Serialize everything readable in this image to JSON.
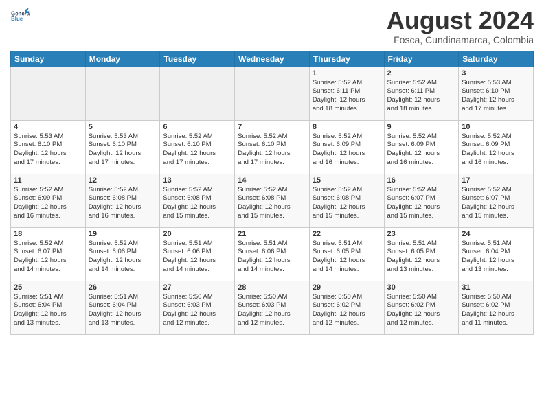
{
  "header": {
    "logo_general": "General",
    "logo_blue": "Blue",
    "month_year": "August 2024",
    "location": "Fosca, Cundinamarca, Colombia"
  },
  "weekdays": [
    "Sunday",
    "Monday",
    "Tuesday",
    "Wednesday",
    "Thursday",
    "Friday",
    "Saturday"
  ],
  "weeks": [
    [
      {
        "day": "",
        "info": ""
      },
      {
        "day": "",
        "info": ""
      },
      {
        "day": "",
        "info": ""
      },
      {
        "day": "",
        "info": ""
      },
      {
        "day": "1",
        "info": "Sunrise: 5:52 AM\nSunset: 6:11 PM\nDaylight: 12 hours\nand 18 minutes."
      },
      {
        "day": "2",
        "info": "Sunrise: 5:52 AM\nSunset: 6:11 PM\nDaylight: 12 hours\nand 18 minutes."
      },
      {
        "day": "3",
        "info": "Sunrise: 5:53 AM\nSunset: 6:10 PM\nDaylight: 12 hours\nand 17 minutes."
      }
    ],
    [
      {
        "day": "4",
        "info": "Sunrise: 5:53 AM\nSunset: 6:10 PM\nDaylight: 12 hours\nand 17 minutes."
      },
      {
        "day": "5",
        "info": "Sunrise: 5:53 AM\nSunset: 6:10 PM\nDaylight: 12 hours\nand 17 minutes."
      },
      {
        "day": "6",
        "info": "Sunrise: 5:52 AM\nSunset: 6:10 PM\nDaylight: 12 hours\nand 17 minutes."
      },
      {
        "day": "7",
        "info": "Sunrise: 5:52 AM\nSunset: 6:10 PM\nDaylight: 12 hours\nand 17 minutes."
      },
      {
        "day": "8",
        "info": "Sunrise: 5:52 AM\nSunset: 6:09 PM\nDaylight: 12 hours\nand 16 minutes."
      },
      {
        "day": "9",
        "info": "Sunrise: 5:52 AM\nSunset: 6:09 PM\nDaylight: 12 hours\nand 16 minutes."
      },
      {
        "day": "10",
        "info": "Sunrise: 5:52 AM\nSunset: 6:09 PM\nDaylight: 12 hours\nand 16 minutes."
      }
    ],
    [
      {
        "day": "11",
        "info": "Sunrise: 5:52 AM\nSunset: 6:09 PM\nDaylight: 12 hours\nand 16 minutes."
      },
      {
        "day": "12",
        "info": "Sunrise: 5:52 AM\nSunset: 6:08 PM\nDaylight: 12 hours\nand 16 minutes."
      },
      {
        "day": "13",
        "info": "Sunrise: 5:52 AM\nSunset: 6:08 PM\nDaylight: 12 hours\nand 15 minutes."
      },
      {
        "day": "14",
        "info": "Sunrise: 5:52 AM\nSunset: 6:08 PM\nDaylight: 12 hours\nand 15 minutes."
      },
      {
        "day": "15",
        "info": "Sunrise: 5:52 AM\nSunset: 6:08 PM\nDaylight: 12 hours\nand 15 minutes."
      },
      {
        "day": "16",
        "info": "Sunrise: 5:52 AM\nSunset: 6:07 PM\nDaylight: 12 hours\nand 15 minutes."
      },
      {
        "day": "17",
        "info": "Sunrise: 5:52 AM\nSunset: 6:07 PM\nDaylight: 12 hours\nand 15 minutes."
      }
    ],
    [
      {
        "day": "18",
        "info": "Sunrise: 5:52 AM\nSunset: 6:07 PM\nDaylight: 12 hours\nand 14 minutes."
      },
      {
        "day": "19",
        "info": "Sunrise: 5:52 AM\nSunset: 6:06 PM\nDaylight: 12 hours\nand 14 minutes."
      },
      {
        "day": "20",
        "info": "Sunrise: 5:51 AM\nSunset: 6:06 PM\nDaylight: 12 hours\nand 14 minutes."
      },
      {
        "day": "21",
        "info": "Sunrise: 5:51 AM\nSunset: 6:06 PM\nDaylight: 12 hours\nand 14 minutes."
      },
      {
        "day": "22",
        "info": "Sunrise: 5:51 AM\nSunset: 6:05 PM\nDaylight: 12 hours\nand 14 minutes."
      },
      {
        "day": "23",
        "info": "Sunrise: 5:51 AM\nSunset: 6:05 PM\nDaylight: 12 hours\nand 13 minutes."
      },
      {
        "day": "24",
        "info": "Sunrise: 5:51 AM\nSunset: 6:04 PM\nDaylight: 12 hours\nand 13 minutes."
      }
    ],
    [
      {
        "day": "25",
        "info": "Sunrise: 5:51 AM\nSunset: 6:04 PM\nDaylight: 12 hours\nand 13 minutes."
      },
      {
        "day": "26",
        "info": "Sunrise: 5:51 AM\nSunset: 6:04 PM\nDaylight: 12 hours\nand 13 minutes."
      },
      {
        "day": "27",
        "info": "Sunrise: 5:50 AM\nSunset: 6:03 PM\nDaylight: 12 hours\nand 12 minutes."
      },
      {
        "day": "28",
        "info": "Sunrise: 5:50 AM\nSunset: 6:03 PM\nDaylight: 12 hours\nand 12 minutes."
      },
      {
        "day": "29",
        "info": "Sunrise: 5:50 AM\nSunset: 6:02 PM\nDaylight: 12 hours\nand 12 minutes."
      },
      {
        "day": "30",
        "info": "Sunrise: 5:50 AM\nSunset: 6:02 PM\nDaylight: 12 hours\nand 12 minutes."
      },
      {
        "day": "31",
        "info": "Sunrise: 5:50 AM\nSunset: 6:02 PM\nDaylight: 12 hours\nand 11 minutes."
      }
    ]
  ]
}
